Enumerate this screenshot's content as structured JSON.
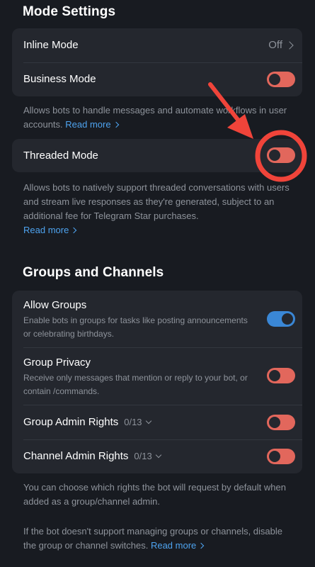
{
  "mode_settings": {
    "title": "Mode Settings",
    "inline_mode": {
      "label": "Inline Mode",
      "value": "Off"
    },
    "business_mode": {
      "label": "Business Mode",
      "enabled": false
    },
    "business_desc": "Allows bots to handle messages and automate workflows in user accounts.",
    "business_link": "Read more",
    "threaded_mode": {
      "label": "Threaded Mode",
      "enabled": false
    },
    "threaded_desc": "Allows bots to natively support threaded conversations with users and stream live responses as they're generated, subject to an additional fee for Telegram Star purchases.",
    "threaded_link": "Read more"
  },
  "groups": {
    "title": "Groups and Channels",
    "allow_groups": {
      "label": "Allow Groups",
      "sub": "Enable bots in groups for tasks like posting announcements or celebrating birthdays.",
      "enabled": true
    },
    "group_privacy": {
      "label": "Group Privacy",
      "sub": "Receive only messages that mention or reply to your bot, or contain /commands.",
      "enabled": false
    },
    "group_admin": {
      "label": "Group Admin Rights",
      "count": "0/13",
      "enabled": false
    },
    "channel_admin": {
      "label": "Channel Admin Rights",
      "count": "0/13",
      "enabled": false
    },
    "rights_desc": "You can choose which rights the bot will request by default when added as a group/channel admin.",
    "switch_desc": "If the bot doesn't support managing groups or channels, disable the group or channel switches.",
    "switch_link": "Read more"
  },
  "colors": {
    "background": "#181b21",
    "card": "#24272e",
    "toggle_off": "#e2675c",
    "toggle_on": "#3a87d6",
    "link": "#4ea3ef",
    "annotation": "#f0443a"
  }
}
